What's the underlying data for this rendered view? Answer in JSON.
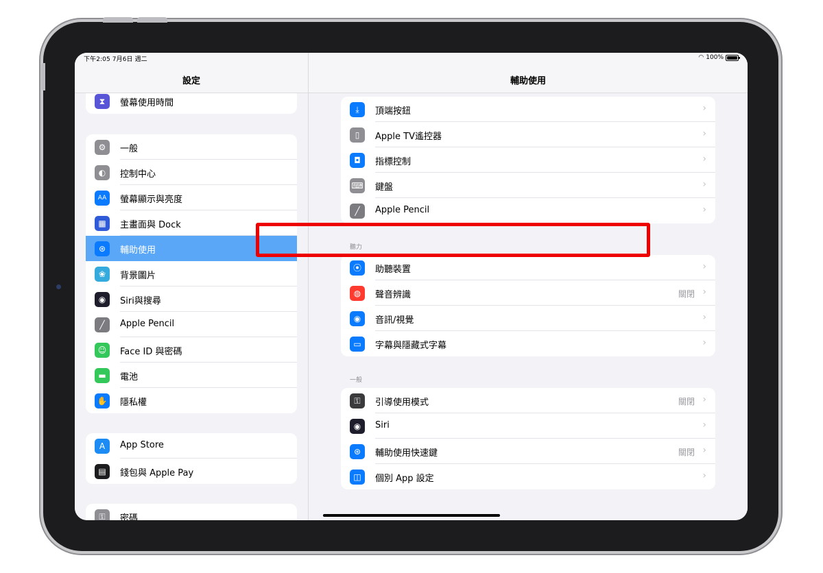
{
  "status_bar": {
    "time": "下午2:05  7月6日 週二",
    "battery": "100%"
  },
  "sidebar": {
    "title": "設定",
    "group1": [
      {
        "label": "螢幕使用時間",
        "icon": "hourglass-icon",
        "color": "#5856d6",
        "glyph": "⧗"
      }
    ],
    "group2": [
      {
        "label": "一般",
        "icon": "gear-icon",
        "color": "#8e8e93",
        "glyph": "⚙"
      },
      {
        "label": "控制中心",
        "icon": "toggles-icon",
        "color": "#8e8e93",
        "glyph": "◐"
      },
      {
        "label": "螢幕顯示與亮度",
        "icon": "text-size-icon",
        "color": "#0a7aff",
        "glyph": "AA"
      },
      {
        "label": "主畫面與 Dock",
        "icon": "home-grid-icon",
        "color": "#2f5bd9",
        "glyph": "▦"
      },
      {
        "label": "輔助使用",
        "icon": "accessibility-icon",
        "color": "#0a7aff",
        "glyph": "⊛",
        "selected": true
      },
      {
        "label": "背景圖片",
        "icon": "wallpaper-flower-icon",
        "color": "#35aadc",
        "glyph": "❀"
      },
      {
        "label": "Siri與搜尋",
        "icon": "siri-icon",
        "color": "#1d1d2b",
        "glyph": "◉"
      },
      {
        "label": "Apple Pencil",
        "icon": "pencil-icon",
        "color": "#7c7c80",
        "glyph": "╱"
      },
      {
        "label": "Face ID 與密碼",
        "icon": "face-id-icon",
        "color": "#34c759",
        "glyph": "☺"
      },
      {
        "label": "電池",
        "icon": "battery-icon",
        "color": "#34c759",
        "glyph": "▬"
      },
      {
        "label": "隱私權",
        "icon": "hand-icon",
        "color": "#0a7aff",
        "glyph": "✋"
      }
    ],
    "group3": [
      {
        "label": "App Store",
        "icon": "app-store-icon",
        "color": "#1c8cf4",
        "glyph": "A"
      },
      {
        "label": "錢包與 Apple Pay",
        "icon": "wallet-icon",
        "color": "#1c1c1e",
        "glyph": "▤"
      }
    ],
    "group4": [
      {
        "label": "密碼",
        "icon": "key-icon",
        "color": "#8e8e93",
        "glyph": "⚿"
      }
    ]
  },
  "detail": {
    "title": "輔助使用",
    "group_physical": [
      {
        "label": "頂端按鈕",
        "icon": "top-button-icon",
        "color": "#0a7aff",
        "glyph": "⤓",
        "value": ""
      },
      {
        "label": "Apple TV遙控器",
        "icon": "remote-icon",
        "color": "#8e8e93",
        "glyph": "▯",
        "value": ""
      },
      {
        "label": "指標控制",
        "icon": "pointer-icon",
        "color": "#0a7aff",
        "glyph": "◘",
        "value": ""
      },
      {
        "label": "鍵盤",
        "icon": "keyboard-icon",
        "color": "#8e8e93",
        "glyph": "⌨",
        "value": ""
      },
      {
        "label": "Apple Pencil",
        "icon": "pencil-icon",
        "color": "#7c7c80",
        "glyph": "╱",
        "value": ""
      }
    ],
    "section_hearing": "聽力",
    "group_hearing": [
      {
        "label": "助聽裝置",
        "icon": "ear-icon",
        "color": "#0a7aff",
        "glyph": "⦿",
        "value": ""
      },
      {
        "label": "聲音辨識",
        "icon": "sound-recognition-icon",
        "color": "#ff3b30",
        "glyph": "◍",
        "value": "關閉"
      },
      {
        "label": "音訊/視覺",
        "icon": "audio-visual-icon",
        "color": "#0a7aff",
        "glyph": "◉",
        "value": ""
      },
      {
        "label": "字幕與隱藏式字幕",
        "icon": "subtitles-icon",
        "color": "#0a7aff",
        "glyph": "▭",
        "value": ""
      }
    ],
    "section_general": "一般",
    "group_general": [
      {
        "label": "引導使用模式",
        "icon": "lock-icon",
        "color": "#3a3a3c",
        "glyph": "⚿",
        "value": "關閉"
      },
      {
        "label": "Siri",
        "icon": "siri-icon",
        "color": "#1d1d2b",
        "glyph": "◉",
        "value": ""
      },
      {
        "label": "輔助使用快速鍵",
        "icon": "accessibility-icon",
        "color": "#0a7aff",
        "glyph": "⊛",
        "value": "關閉"
      },
      {
        "label": "個別 App 設定",
        "icon": "per-app-icon",
        "color": "#0a7aff",
        "glyph": "◫",
        "value": ""
      }
    ]
  }
}
